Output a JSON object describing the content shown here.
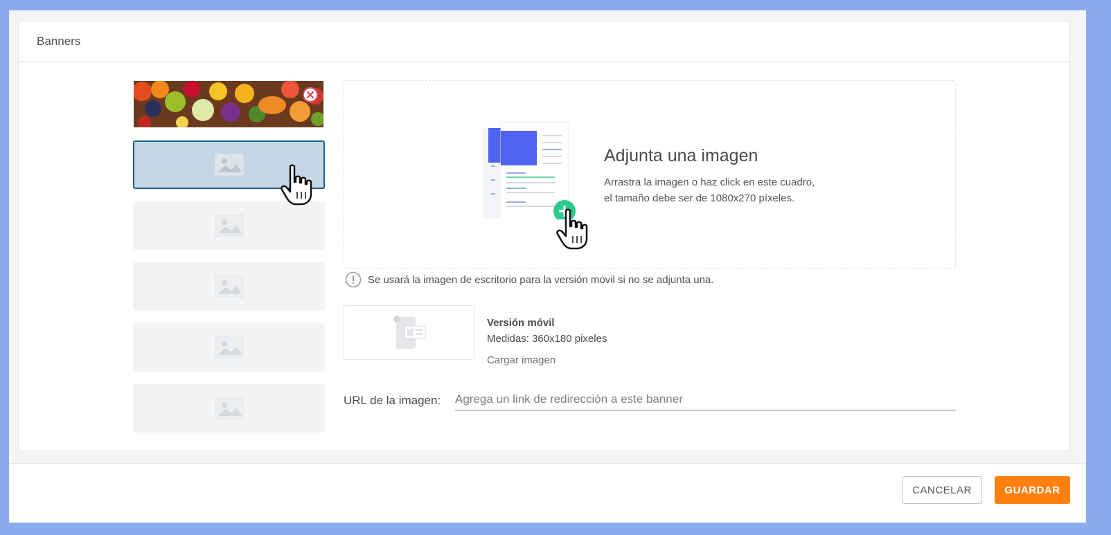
{
  "card": {
    "title": "Banners"
  },
  "dropzone": {
    "title": "Adjunta una imagen",
    "line1": "Arrastra la imagen o haz click en este cuadro,",
    "line2": "el tamaño debe ser de 1080x270 píxeles."
  },
  "notice": "Se usará la imagen de escritorio para la versión movil si no se adjunta una.",
  "mobile": {
    "title": "Versión móvil",
    "size": "Medidas: 360x180 pixeles",
    "load": "Cargar imagen"
  },
  "url": {
    "label": "URL de la imagen:",
    "placeholder": "Agrega un link de redirección a este banner",
    "value": ""
  },
  "footer": {
    "cancel": "CANCELAR",
    "save": "GUARDAR"
  },
  "colors": {
    "background": "#8aacef",
    "selected_slot": "#c3d8e4",
    "selected_border": "#1f5f86",
    "accent": "#ff7f0f",
    "upload_badge": "#2ec98e",
    "doc_blue": "#4f64f0"
  },
  "icons": [
    "image-placeholder-icon",
    "remove-icon",
    "info-icon",
    "hand-cursor-icon",
    "plus-icon",
    "mobile-device-icon"
  ]
}
